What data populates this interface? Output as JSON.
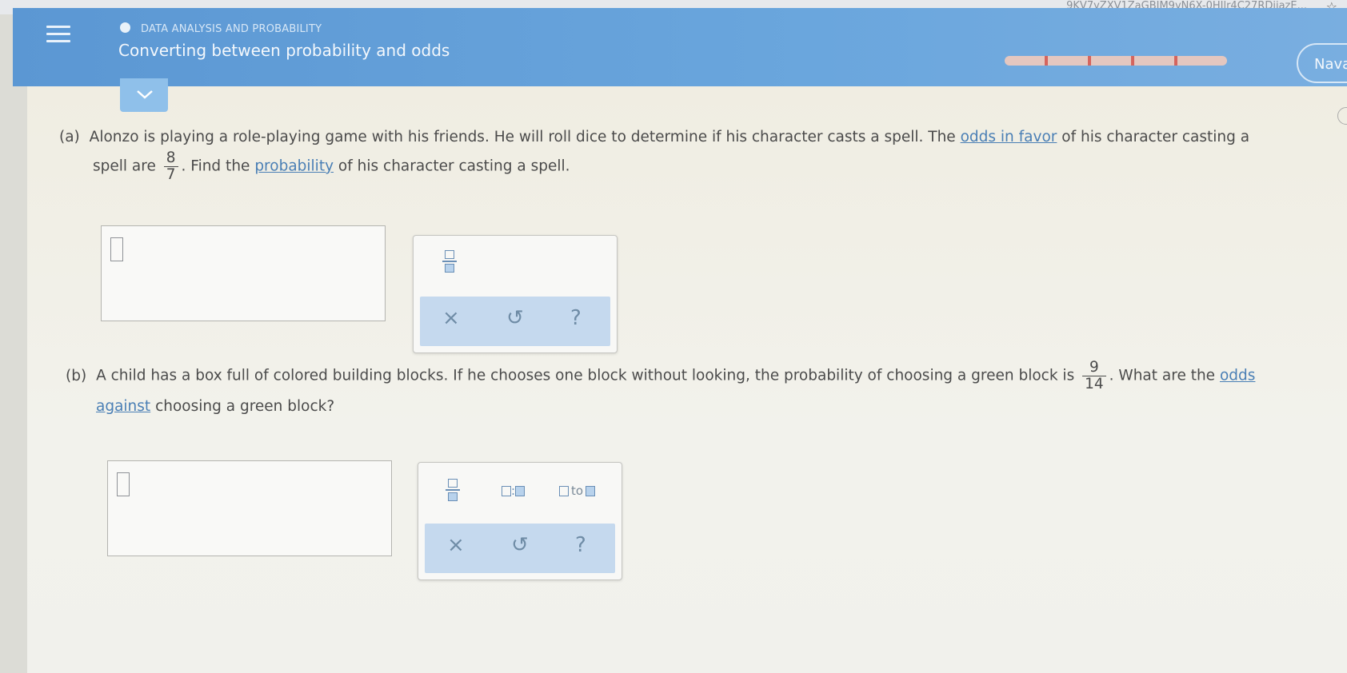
{
  "browser": {
    "url_fragment": "9KV7yZXV1ZaGBJM9yN6X-0HIlr4C27RDjiazE...",
    "star_icon": "star-icon"
  },
  "header": {
    "topic": "DATA ANALYSIS AND PROBABILITY",
    "title": "Converting between probability and odds",
    "user_label": "Navan",
    "progress_segments": 5,
    "colors": {
      "bar": "#5b97d3",
      "progress": "#d5655e"
    }
  },
  "question_a": {
    "label": "(a)",
    "text_1": "Alonzo is playing a role-playing game with his friends. He will roll dice to determine if his character casts a spell. The",
    "link_1": "odds in favor",
    "text_2": "of his character casting a",
    "text_3": "spell are",
    "frac_num": "8",
    "frac_den": "7",
    "text_4": ". Find the",
    "link_2": "probability",
    "text_5": "of his character casting a spell."
  },
  "question_b": {
    "label": "(b)",
    "text_1": "A child has a box full of colored building blocks. If he chooses one block without looking, the probability of choosing a green block is",
    "frac_num": "9",
    "frac_den": "14",
    "text_2": ". What are the",
    "link_1": "odds",
    "link_2": "against",
    "text_3": "choosing a green block?"
  },
  "palette": {
    "clear_symbol": "×",
    "undo_symbol": "↺",
    "help_symbol": "?",
    "ratio_sep": ":",
    "to_word": "to"
  }
}
